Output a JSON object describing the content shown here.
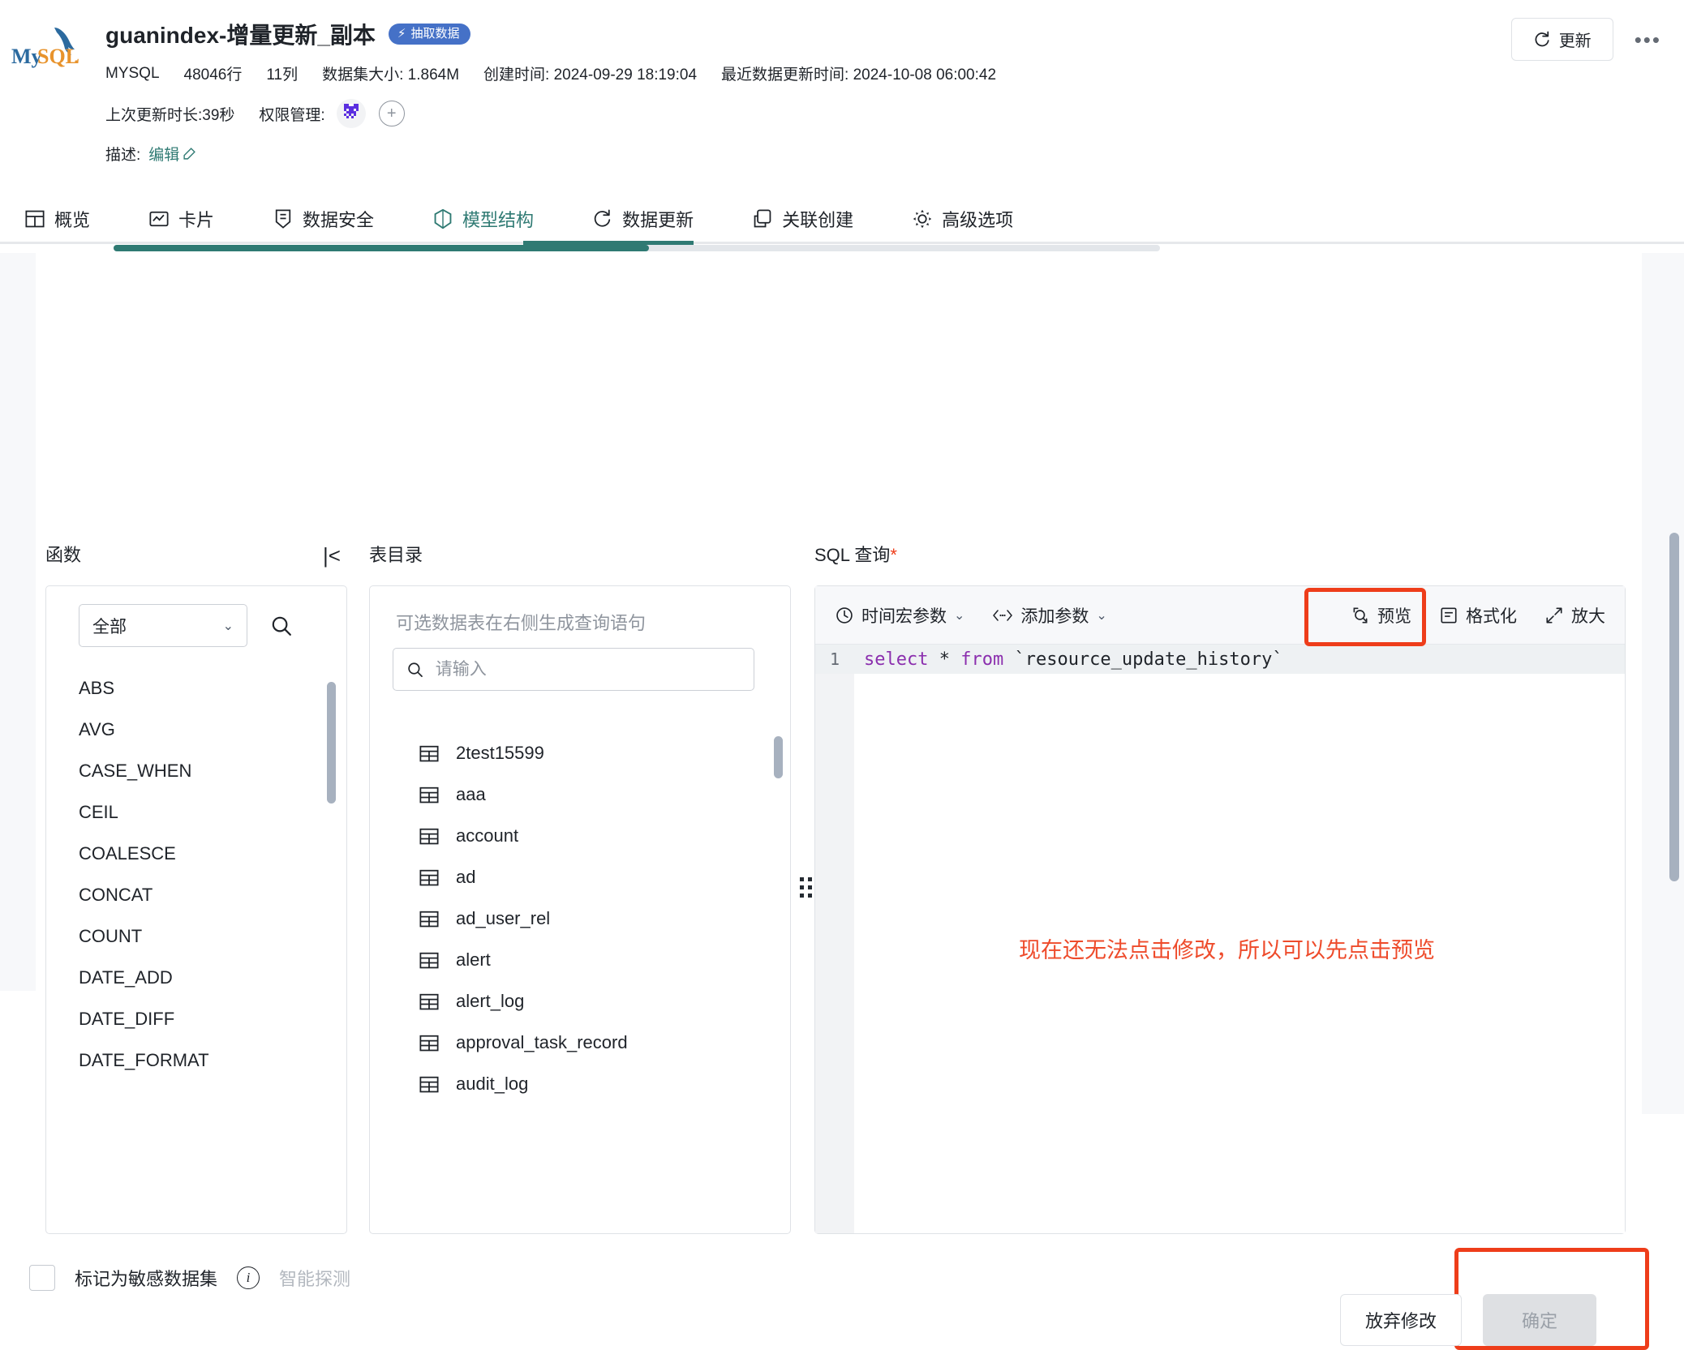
{
  "header": {
    "logo_alt": "MySQL",
    "title": "guanindex-增量更新_副本",
    "badge": "抽取数据",
    "meta": {
      "engine": "MYSQL",
      "rows": "48046行",
      "columns": "11列",
      "size": "数据集大小: 1.864M",
      "created": "创建时间: 2024-09-29 18:19:04",
      "updated": "最近数据更新时间: 2024-10-08 06:00:42"
    },
    "last_duration": "上次更新时长:39秒",
    "permission_label": "权限管理:",
    "description_label": "描述:",
    "description_edit": "编辑",
    "update_button": "更新",
    "more_button": "•••"
  },
  "tabs": [
    {
      "label": "概览",
      "icon": "grid-icon",
      "active": false
    },
    {
      "label": "卡片",
      "icon": "card-icon",
      "active": false
    },
    {
      "label": "数据安全",
      "icon": "shield-doc-icon",
      "active": false
    },
    {
      "label": "模型结构",
      "icon": "cube-icon",
      "active": true
    },
    {
      "label": "数据更新",
      "icon": "refresh-icon",
      "active": false
    },
    {
      "label": "关联创建",
      "icon": "link-icon",
      "active": false
    },
    {
      "label": "高级选项",
      "icon": "gear-icon",
      "active": false
    }
  ],
  "functions_panel": {
    "title": "函数",
    "filter_value": "全部",
    "items": [
      "ABS",
      "AVG",
      "CASE_WHEN",
      "CEIL",
      "COALESCE",
      "CONCAT",
      "COUNT",
      "DATE_ADD",
      "DATE_DIFF",
      "DATE_FORMAT"
    ]
  },
  "tables_panel": {
    "title": "表目录",
    "hint": "可选数据表在右侧生成查询语句",
    "search_placeholder": "请输入",
    "search_value": "",
    "items": [
      "2test15599",
      "aaa",
      "account",
      "ad",
      "ad_user_rel",
      "alert",
      "alert_log",
      "approval_task_record",
      "audit_log"
    ]
  },
  "sql_panel": {
    "title": "SQL 查询",
    "required_mark": "*",
    "toolbar": {
      "time_macro": "时间宏参数",
      "add_param": "添加参数",
      "preview": "预览",
      "format": "格式化",
      "expand": "放大"
    },
    "editor": {
      "line_number": "1",
      "code_kw1": "select",
      "code_star": " * ",
      "code_kw2": "from",
      "code_ident": " `resource_update_history`"
    }
  },
  "annotation": {
    "text": "现在还无法点击修改，所以可以先点击预览",
    "color": "#ee4b2b",
    "highlight_color": "#ee3d1a"
  },
  "bottom": {
    "sensitive_label": "标记为敏感数据集",
    "smart_detect": "智能探测",
    "discard_button": "放弃修改",
    "confirm_button": "确定"
  },
  "colors": {
    "accent_teal": "#2f7a73",
    "badge_blue": "#4571c7",
    "avatar_purple": "#5b2fe0",
    "annotation_red": "#ee3d1a"
  }
}
